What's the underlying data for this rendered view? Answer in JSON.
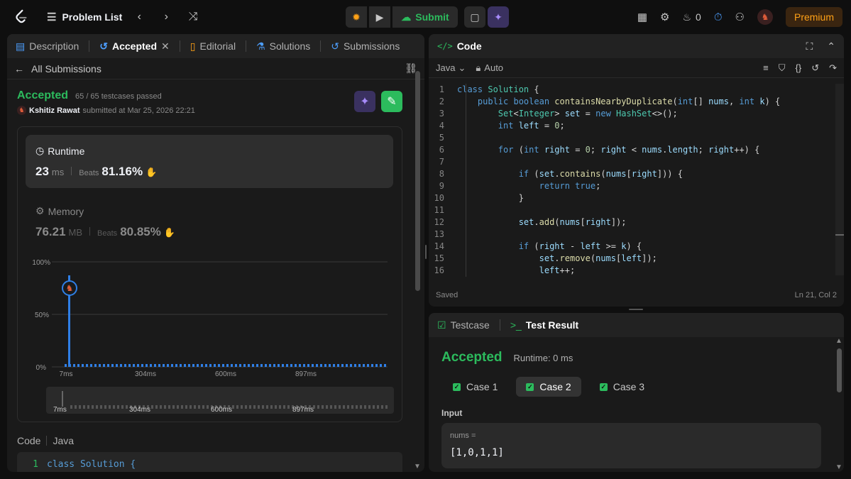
{
  "topbar": {
    "problem_list": "Problem List",
    "submit": "Submit",
    "streak_count": "0",
    "premium": "Premium"
  },
  "left_tabs": [
    {
      "label": "Description"
    },
    {
      "label": "Accepted"
    },
    {
      "label": "Editorial"
    },
    {
      "label": "Solutions"
    },
    {
      "label": "Submissions"
    }
  ],
  "submission": {
    "back_label": "All Submissions",
    "status": "Accepted",
    "testcases": "65 / 65 testcases passed",
    "user": "Kshitiz Rawat",
    "submitted_text": "submitted at Mar 25, 2026 22:21",
    "runtime_label": "Runtime",
    "runtime_value": "23",
    "runtime_unit": "ms",
    "beats_label": "Beats",
    "runtime_beats": "81.16%",
    "memory_label": "Memory",
    "memory_value": "76.21",
    "memory_unit": "MB",
    "memory_beats": "80.85%",
    "code_label": "Code",
    "code_lang": "Java",
    "code_preview_line": "1",
    "code_preview": "class Solution {"
  },
  "chart_data": {
    "type": "bar",
    "y_ticks": [
      "100%",
      "50%",
      "0%"
    ],
    "x_ticks": [
      "7ms",
      "304ms",
      "600ms",
      "897ms"
    ],
    "ylim": [
      0,
      100
    ],
    "highlight": {
      "x": "7ms",
      "value": 85
    },
    "mini_x_ticks": [
      "7ms",
      "304ms",
      "600ms",
      "897ms"
    ]
  },
  "editor": {
    "title": "Code",
    "language": "Java",
    "mode": "Auto",
    "saved": "Saved",
    "cursor": "Ln 21, Col 2"
  },
  "code_lines": [
    {
      "n": "1"
    },
    {
      "n": "2"
    },
    {
      "n": "3"
    },
    {
      "n": "4"
    },
    {
      "n": "5"
    },
    {
      "n": "6"
    },
    {
      "n": "7"
    },
    {
      "n": "8"
    },
    {
      "n": "9"
    },
    {
      "n": "10"
    },
    {
      "n": "11"
    },
    {
      "n": "12"
    },
    {
      "n": "13"
    },
    {
      "n": "14"
    },
    {
      "n": "15"
    },
    {
      "n": "16"
    }
  ],
  "code": {
    "l1": [
      "class ",
      "Solution",
      " {"
    ],
    "l2": [
      "public ",
      "boolean ",
      "containsNearbyDuplicate",
      "(",
      "int",
      "[] ",
      "nums",
      ", ",
      "int ",
      "k",
      ") {"
    ],
    "l3": [
      "Set",
      "<",
      "Integer",
      "> ",
      "set",
      " = ",
      "new ",
      "HashSet",
      "<>();"
    ],
    "l4": [
      "int ",
      "left",
      " = ",
      "0",
      ";"
    ],
    "l6": [
      "for ",
      "(",
      "int ",
      "right",
      " = ",
      "0",
      "; ",
      "right",
      " < ",
      "nums",
      ".",
      "length",
      "; ",
      "right",
      "++) {"
    ],
    "l8": [
      "if ",
      "(",
      "set",
      ".",
      "contains",
      "(",
      "nums",
      "[",
      "right",
      "])) {"
    ],
    "l9": [
      "return ",
      "true",
      ";"
    ],
    "l10": [
      "}"
    ],
    "l12": [
      "set",
      ".",
      "add",
      "(",
      "nums",
      "[",
      "right",
      "]);"
    ],
    "l14": [
      "if ",
      "(",
      "right",
      " - ",
      "left",
      " >= ",
      "k",
      ") {"
    ],
    "l15": [
      "set",
      ".",
      "remove",
      "(",
      "nums",
      "[",
      "left",
      "]);"
    ],
    "l16": [
      "left",
      "++;"
    ]
  },
  "result": {
    "testcase_tab": "Testcase",
    "result_tab": "Test Result",
    "status": "Accepted",
    "runtime": "Runtime: 0 ms",
    "cases": [
      {
        "label": "Case 1"
      },
      {
        "label": "Case 2"
      },
      {
        "label": "Case 3"
      }
    ],
    "input_label": "Input",
    "var_name": "nums =",
    "var_value": "[1,0,1,1]"
  }
}
